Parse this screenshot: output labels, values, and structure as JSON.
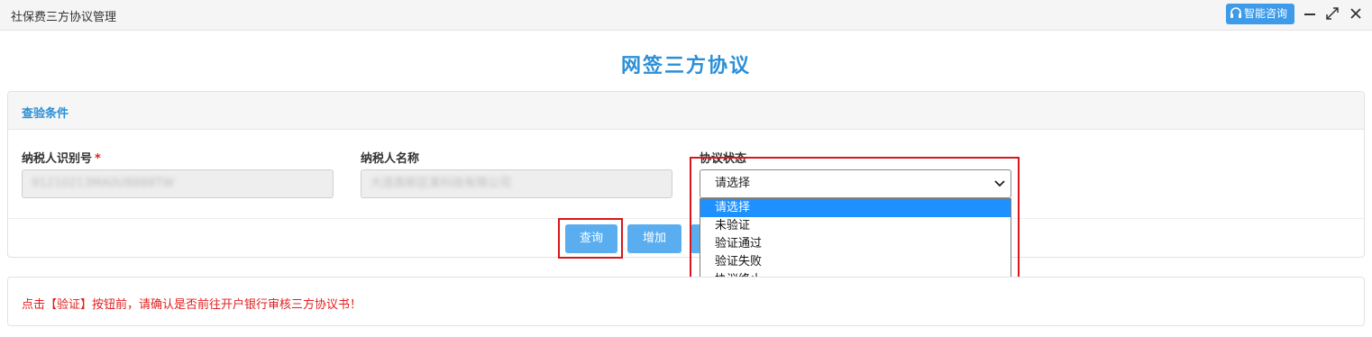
{
  "window": {
    "title": "社保费三方协议管理",
    "ai_consult": "智能咨询",
    "controls": [
      "minimize-icon",
      "maximize-icon",
      "close-icon"
    ]
  },
  "page": {
    "heading": "网签三方协议"
  },
  "query_panel": {
    "title": "查验条件",
    "fields": {
      "taxpayer_id": {
        "label": "纳税人识别号",
        "required_mark": "*",
        "value": "91210213MA0U8888TW"
      },
      "taxpayer_name": {
        "label": "纳税人名称",
        "value": "大连高新区某科技有限公司"
      },
      "agreement_status": {
        "label": "协议状态",
        "selected": "请选择",
        "options": [
          "请选择",
          "未验证",
          "验证通过",
          "验证失败",
          "协议终止"
        ]
      }
    },
    "buttons": {
      "query": "查询",
      "add": "增加"
    }
  },
  "notice": {
    "text": "点击【验证】按钮前，请确认是否前往开户银行审核三方协议书！"
  },
  "colors": {
    "accent": "#2a8fd7",
    "button": "#5aaef0",
    "alert": "#e02020",
    "highlight": "#1e90ff"
  }
}
